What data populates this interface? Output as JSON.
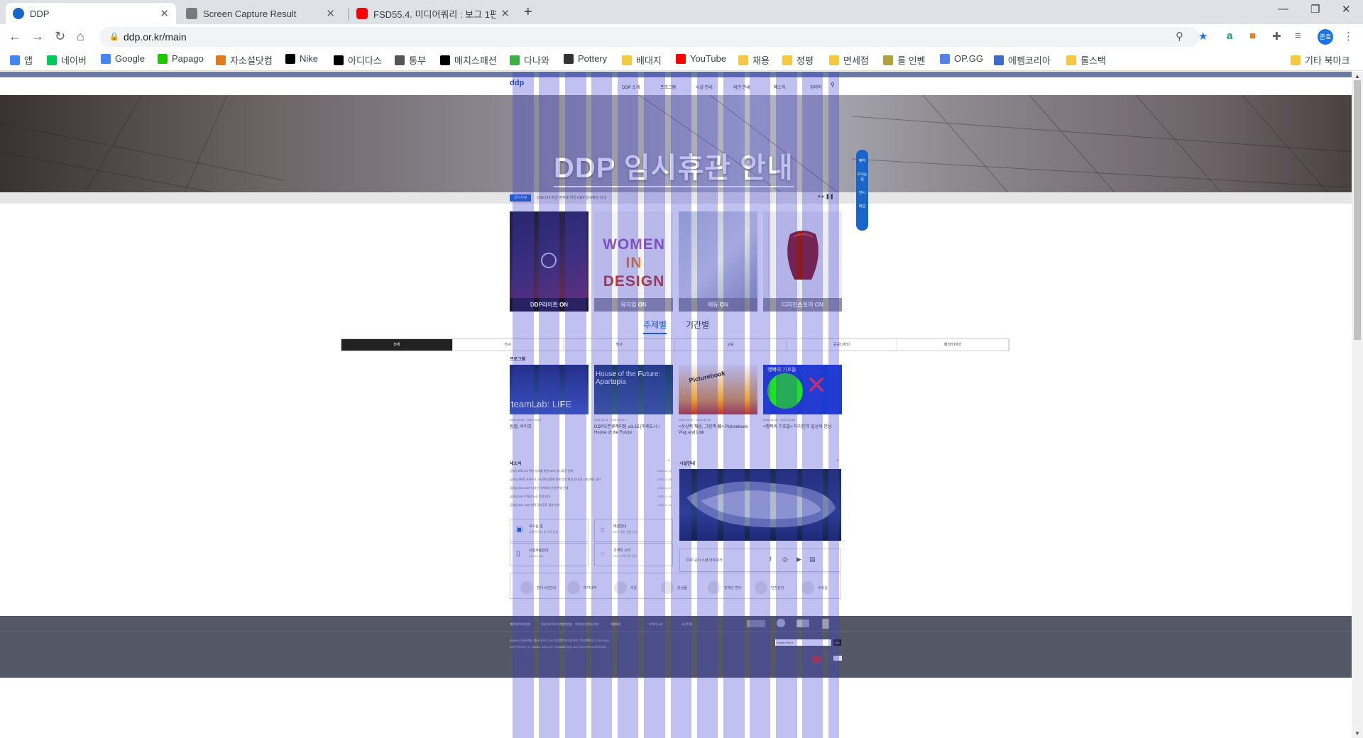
{
  "browser": {
    "tabs": [
      {
        "title": "DDP",
        "active": true,
        "favicon_color": "#1a66c8"
      },
      {
        "title": "Screen Capture Result",
        "active": false,
        "favicon_color": "#7a7a7a"
      },
      {
        "title": "FSD55.4. 미디어쿼리 : 보그 1편",
        "active": false,
        "favicon_color": "#ff0000"
      }
    ],
    "url": "ddp.or.kr/main",
    "profile_initial": "준호",
    "bookmarks": [
      {
        "label": "앱",
        "color": "#4285f4"
      },
      {
        "label": "네이버",
        "color": "#03c75a"
      },
      {
        "label": "Google",
        "color": "#4285f4"
      },
      {
        "label": "Papago",
        "color": "#1ec800"
      },
      {
        "label": "자소설닷컴",
        "color": "#e07a1f"
      },
      {
        "label": "Nike",
        "color": "#000000"
      },
      {
        "label": "아디다스",
        "color": "#000000"
      },
      {
        "label": "통부",
        "color": "#555555"
      },
      {
        "label": "매치스패션",
        "color": "#000000"
      },
      {
        "label": "다나와",
        "color": "#3cb043"
      },
      {
        "label": "Pottery",
        "color": "#333333"
      },
      {
        "label": "배대지",
        "color": "#f5c842"
      },
      {
        "label": "YouTube",
        "color": "#ff0000"
      },
      {
        "label": "채용",
        "color": "#f5c842"
      },
      {
        "label": "정평",
        "color": "#f5c842"
      },
      {
        "label": "면세점",
        "color": "#f5c842"
      },
      {
        "label": "롤 인벤",
        "color": "#b0a040"
      },
      {
        "label": "OP.GG",
        "color": "#5383e8"
      },
      {
        "label": "에펨코리아",
        "color": "#3d6bc7"
      },
      {
        "label": "롤스택",
        "color": "#f5c842"
      }
    ],
    "other_bookmarks": "기타 북마크"
  },
  "site": {
    "logo": "ddp",
    "gnb": [
      "DDP 소개",
      "프로그램",
      "시설 안내",
      "대관 안내",
      "예스치",
      "참여하"
    ],
    "hero_title": "DDP 임시휴관 안내",
    "notice_badge": "공지사항",
    "notice_text": "코로나19 확산 방지를 위한 DDP 임시휴관 안내",
    "quick_menu": [
      "예약",
      "오시는길",
      "전시",
      "대관"
    ],
    "cards": [
      {
        "label": "DDP라이트 ON"
      },
      {
        "label": "뮤지엄 ON"
      },
      {
        "label": "에듀 ON"
      },
      {
        "label": "디자인스토어 ON"
      }
    ],
    "women_in_design": [
      "WOMEN",
      "IN",
      "DESIGN"
    ],
    "view_tabs": [
      "주제별",
      "기간별"
    ],
    "filters": [
      "전체",
      "전시",
      "행사",
      "교육",
      "공공디자인",
      "패션/디자인"
    ],
    "program_label": "프로그램",
    "programs": [
      {
        "date": "2020.09.25 ~ 2021.04.04",
        "title": "팀랩: 라이프",
        "thumb_text": "teamLab: LIFE"
      },
      {
        "date": "2020.12.11 ~ 2021.03.31",
        "title": "DDP오픈큐레이팅 vol.15 [미래도시 / House of the Future :",
        "thumb_text": "House of the Future: Apartopia"
      },
      {
        "date": "2020.12.24 ~ 2021.02.14",
        "title": "<상상력 채움, 그림책 展> Picturebook: Play and Link",
        "thumb_text": "Picturebook"
      },
      {
        "date": "2020.11.06 ~ 2021.01.03",
        "title": "<행복의 기호들> 디자인과 일상의 만남",
        "thumb_text": "행복의 기호들"
      }
    ],
    "news_label": "새소식",
    "news": [
      {
        "title": "[공지] 코로나19 확산 방지를 위한 DDP 임시휴관 안내",
        "date": "2020.12.23"
      },
      {
        "title": "[공지] 사회적 거리두기 2.5단계 상향에 따른 운영 변경 안내 및 시설 관련 공지",
        "date": "2020.12.08"
      },
      {
        "title": "[공지] 2020 DDP 디자인 아카데미 운영 변경 안내",
        "date": "2020.11.27"
      },
      {
        "title": "[공지] DDP 주차장 요금 조정 안내",
        "date": "2020.11.19"
      },
      {
        "title": "[공지] 2021 DDP 대관 정기공모 결과 안내",
        "date": "2020.11.10"
      }
    ],
    "facility_label": "시설안내",
    "services": [
      {
        "title": "오시는 길",
        "sub": "교통편 안내 및 주차 안내",
        "icon": "bus-icon"
      },
      {
        "title": "대관안내",
        "sub": "DDP 대관 신청 안내",
        "icon": "building-icon"
      },
      {
        "title": "시설사용안내",
        "sub": "Facility Info",
        "icon": "door-icon"
      },
      {
        "title": "고객의 소리",
        "sub": "DDP 고객 의견 접수",
        "icon": "chat-icon"
      }
    ],
    "sns_text": "DDP 공식 소셜 네트워크",
    "utility_icons": [
      "편의시설안내",
      "예약내역",
      "셔틀",
      "분실물",
      "장애인 편의",
      "안전관리",
      "수유실"
    ],
    "footer_links": [
      "개인정보처리방침",
      "영상정보처리기기운영방침",
      "이메일무단수집거부",
      "이용약관",
      "고객의 소리",
      "사이트맵"
    ],
    "footer_address": "(04564) 서울특별시 중구 을지로 281 동대문디자인플라자 / 대표전화 02-2153-0000",
    "footer_copy": "COPYRIGHT (c) SEOUL DESIGN FOUNDATION. ALL RIGHTS RESERVED.",
    "family_site": "Family Site",
    "family_go": "GO"
  }
}
